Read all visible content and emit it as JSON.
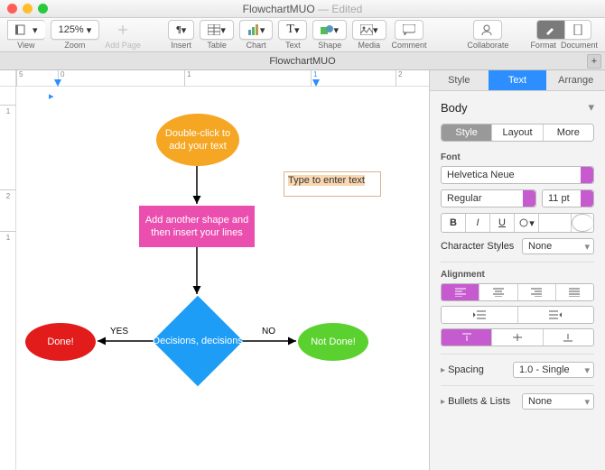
{
  "window": {
    "title": "FlowchartMUO",
    "edited_suffix": " — Edited"
  },
  "toolbar": {
    "view": "View",
    "zoom": "Zoom",
    "zoom_value": "125%",
    "add_page": "Add Page",
    "insert": "Insert",
    "table": "Table",
    "chart": "Chart",
    "text": "Text",
    "shape": "Shape",
    "media": "Media",
    "comment": "Comment",
    "collaborate": "Collaborate",
    "format": "Format",
    "document": "Document"
  },
  "tabstrip": {
    "document_name": "FlowchartMUO"
  },
  "ruler": {
    "h_ticks": [
      "5",
      "0",
      "1",
      "2"
    ],
    "v_ticks": [
      "1",
      "2",
      "1"
    ]
  },
  "shapes": {
    "start": "Double-click to add your text",
    "process": "Add another shape and then insert your lines",
    "decision": "Decisions, decisions",
    "yes": "YES",
    "no": "NO",
    "done": "Done!",
    "not_done": "Not Done!",
    "textbox": "Type to enter text"
  },
  "sidebar": {
    "tabs": {
      "style": "Style",
      "text": "Text",
      "arrange": "Arrange"
    },
    "paragraph_style": "Body",
    "subtabs": {
      "style": "Style",
      "layout": "Layout",
      "more": "More"
    },
    "font_label": "Font",
    "font_family": "Helvetica Neue",
    "font_style": "Regular",
    "font_size": "11 pt",
    "bold": "B",
    "italic": "I",
    "underline": "U",
    "char_styles_label": "Character Styles",
    "char_styles_value": "None",
    "alignment_label": "Alignment",
    "spacing_label": "Spacing",
    "spacing_value": "1.0 - Single",
    "bullets_label": "Bullets & Lists",
    "bullets_value": "None"
  },
  "colors": {
    "accent": "#c65bcf",
    "tab_active": "#2d8eff",
    "shape_orange": "#f5a623",
    "shape_pink": "#ea4fb0",
    "shape_blue": "#1e9df7",
    "shape_red": "#e21b1b",
    "shape_green": "#5bd12f"
  }
}
